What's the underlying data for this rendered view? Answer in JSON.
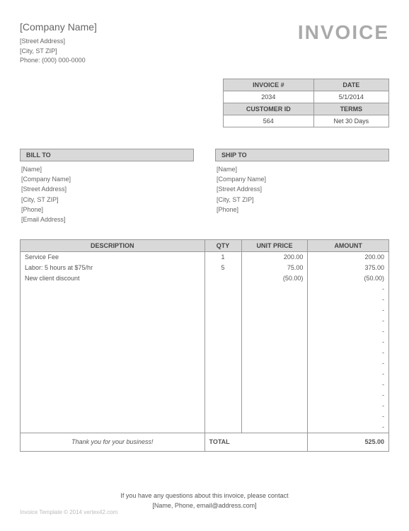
{
  "header": {
    "company_name": "[Company Name]",
    "street": "[Street Address]",
    "city": "[City, ST  ZIP]",
    "phone_label": "Phone:",
    "phone": "(000) 000-0000",
    "title": "INVOICE"
  },
  "meta": {
    "invoice_num_label": "INVOICE #",
    "invoice_num": "2034",
    "date_label": "DATE",
    "date": "5/1/2014",
    "customer_id_label": "CUSTOMER ID",
    "customer_id": "564",
    "terms_label": "TERMS",
    "terms": "Net 30 Days"
  },
  "bill_to": {
    "header": "BILL TO",
    "lines": [
      "[Name]",
      "[Company Name]",
      "[Street Address]",
      "[City, ST  ZIP]",
      "[Phone]",
      "[Email Address]"
    ]
  },
  "ship_to": {
    "header": "SHIP TO",
    "lines": [
      "[Name]",
      "[Company Name]",
      "[Street Address]",
      "[City, ST  ZIP]",
      "[Phone]"
    ]
  },
  "columns": {
    "desc": "DESCRIPTION",
    "qty": "QTY",
    "price": "UNIT PRICE",
    "amount": "AMOUNT"
  },
  "items": [
    {
      "desc": "Service Fee",
      "qty": "1",
      "price": "200.00",
      "amount": "200.00"
    },
    {
      "desc": "Labor: 5 hours at $75/hr",
      "qty": "5",
      "price": "75.00",
      "amount": "375.00"
    },
    {
      "desc": "New client discount",
      "qty": "",
      "price": "(50.00)",
      "amount": "(50.00)"
    },
    {
      "desc": "",
      "qty": "",
      "price": "",
      "amount": "-"
    },
    {
      "desc": "",
      "qty": "",
      "price": "",
      "amount": "-"
    },
    {
      "desc": "",
      "qty": "",
      "price": "",
      "amount": "-"
    },
    {
      "desc": "",
      "qty": "",
      "price": "",
      "amount": "-"
    },
    {
      "desc": "",
      "qty": "",
      "price": "",
      "amount": "-"
    },
    {
      "desc": "",
      "qty": "",
      "price": "",
      "amount": "-"
    },
    {
      "desc": "",
      "qty": "",
      "price": "",
      "amount": "-"
    },
    {
      "desc": "",
      "qty": "",
      "price": "",
      "amount": "-"
    },
    {
      "desc": "",
      "qty": "",
      "price": "",
      "amount": "-"
    },
    {
      "desc": "",
      "qty": "",
      "price": "",
      "amount": "-"
    },
    {
      "desc": "",
      "qty": "",
      "price": "",
      "amount": "-"
    },
    {
      "desc": "",
      "qty": "",
      "price": "",
      "amount": "-"
    },
    {
      "desc": "",
      "qty": "",
      "price": "",
      "amount": "-"
    },
    {
      "desc": "",
      "qty": "",
      "price": "",
      "amount": "-"
    }
  ],
  "total": {
    "thanks": "Thank you for your business!",
    "label": "TOTAL",
    "value": "525.00"
  },
  "footer": {
    "line1": "If you have any questions about this invoice, please contact",
    "line2": "[Name, Phone, email@address.com]"
  },
  "copyright": "Invoice Template © 2014 vertex42.com"
}
